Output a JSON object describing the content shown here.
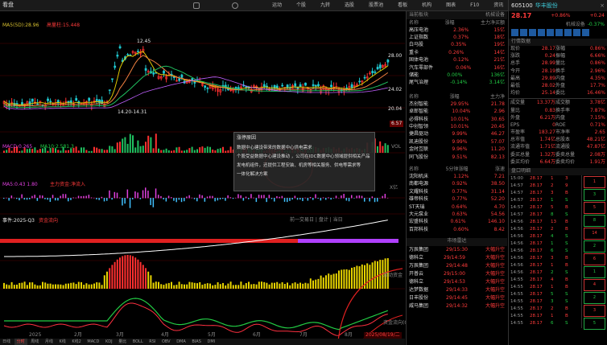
{
  "toolbar": {
    "app_name": "看盘",
    "icons": [
      "refresh-icon",
      "settings-icon",
      "lock-icon",
      "close-icon"
    ],
    "items": [
      "运动",
      "个股",
      "九转",
      "选股",
      "股票池",
      "看板",
      "机构",
      "图表",
      "F10",
      "资讯"
    ],
    "window_buttons": [
      "min",
      "max",
      "close"
    ]
  },
  "chart": {
    "ma_label": "MA5(5D):28.96",
    "highlight_label": "高量柱:15.448",
    "price_high": "12.45",
    "price_labels": [
      "28.00",
      "24.02",
      "20.04",
      "16.06",
      "15.00",
      "12.00"
    ],
    "price_low": "14.20-14.31",
    "mid_label": "14.20-14.31",
    "vol_label": "VOL",
    "vol_value": "6.57",
    "vol_unit": "万手",
    "macd_label": "MACD:0.265",
    "macd_line2": "MA10:2.581.3",
    "ind3_label": "MA5:0.43 1.80",
    "ind3_line2": "主力资金:净流入",
    "ind3_right": "X亿",
    "cyber_label": "事件:2025-Q3",
    "cyber_sub": "资金流向",
    "cyber_right": "前一交易日 | 盘计 | 当日",
    "bottom_label": "资金流向(Q)",
    "bottom_right_label": "流动资金",
    "x_labels": [
      "2025",
      "2月",
      "3月",
      "4月",
      "5月",
      "6月",
      "7月",
      "8月"
    ],
    "date_badge": "2025/08/19/二",
    "y_right": [
      "X亿",
      "X亿",
      "X亿",
      "X亿"
    ]
  },
  "tooltip": {
    "title": "涨停原因",
    "lines": [
      "数据中心建设带来的数据中心供电需求",
      "个股受益数据中心建设推动 ，公司在IDC数据中心领域提供相关产品",
      "发电机组件，还提供工程安装、机房等相关服务、供电等需求等",
      "一体化解决方案"
    ]
  },
  "bottom_tabs": [
    "日线",
    "分时",
    "周线",
    "月线",
    "K线",
    "K线2",
    "MACD",
    "KDJ",
    "量比",
    "BOLL",
    "RSI",
    "OBV",
    "DMA",
    "BIAS",
    "DMI",
    "VR",
    "CCI",
    "WR",
    "SAR",
    "PSY"
  ],
  "bottom_tab_active": 1,
  "sector_panel": {
    "title": "当前板块",
    "title2": "机械设备",
    "col_headers": [
      "名称",
      "涨幅",
      "主力净买额"
    ],
    "rows": [
      {
        "name": "高压电池",
        "pct": "2.36%",
        "amt": "15亿",
        "color": "red"
      },
      {
        "name": "上证指数",
        "pct": "0.37%",
        "amt": "18亿",
        "color": "red"
      },
      {
        "name": "白马股",
        "pct": "0.35%",
        "amt": "19亿",
        "color": "red"
      },
      {
        "name": "重卡",
        "pct": "0.26%",
        "amt": "14亿",
        "color": "red"
      },
      {
        "name": "固体电池",
        "pct": "0.12%",
        "amt": "21亿",
        "color": "red"
      },
      {
        "name": "汽车零部件",
        "pct": "0.06%",
        "amt": "16亿",
        "color": "red"
      },
      {
        "name": "储能",
        "pct": "0.00%",
        "amt": "136亿",
        "color": "grn"
      },
      {
        "name": "尾气治理",
        "pct": "-0.14%",
        "amt": "3.14亿",
        "color": "grn"
      }
    ],
    "section2_headers": [
      "名称",
      "涨幅",
      "主力净"
    ],
    "rows2": [
      {
        "name": "杰创智能",
        "pct": "29.95%",
        "amt": "21.78",
        "color": "red"
      },
      {
        "name": "卓郎智能",
        "pct": "10.04%",
        "amt": "2.96",
        "color": "red"
      },
      {
        "name": "必得科技",
        "pct": "10.01%",
        "amt": "30.65",
        "color": "red"
      },
      {
        "name": "中创智领",
        "pct": "10.01%",
        "amt": "20.45",
        "color": "red"
      },
      {
        "name": "捷昌驱动",
        "pct": "9.99%",
        "amt": "46.27",
        "color": "red"
      },
      {
        "name": "凯迪股份",
        "pct": "9.99%",
        "amt": "57.07",
        "color": "red"
      },
      {
        "name": "金时互联",
        "pct": "9.96%",
        "amt": "11.20",
        "color": "red"
      },
      {
        "name": "同飞股份",
        "pct": "9.51%",
        "amt": "82.13",
        "color": "red"
      }
    ],
    "section3_headers": [
      "名称",
      "5分钟涨幅",
      "涨速"
    ],
    "rows3": [
      {
        "name": "沈阳机床",
        "pct": "1.12%",
        "amt": "7.21",
        "color": "red"
      },
      {
        "name": "南都电源",
        "pct": "0.92%",
        "amt": "38.50",
        "color": "red"
      },
      {
        "name": "文耀科技",
        "pct": "0.77%",
        "amt": "31.14",
        "color": "red"
      },
      {
        "name": "雄帝科技",
        "pct": "0.77%",
        "amt": "52.20",
        "color": "red"
      },
      {
        "name": "ST天瑞",
        "pct": "0.64%",
        "amt": "4.70",
        "color": "red"
      },
      {
        "name": "大元泵业",
        "pct": "0.63%",
        "amt": "54.56",
        "color": "red"
      },
      {
        "name": "宏盛科技",
        "pct": "0.61%",
        "amt": "146.10",
        "color": "red"
      },
      {
        "name": "百邦科技",
        "pct": "0.60%",
        "amt": "8.42",
        "color": "red"
      }
    ],
    "alerts_title": "市场雷达",
    "alerts": [
      {
        "name": "万辰集团",
        "time": "29/15:30",
        "type": "大幅升空"
      },
      {
        "name": "德科立",
        "time": "29/14:59",
        "type": "大幅升空"
      },
      {
        "name": "万辰集团",
        "time": "29/14:48",
        "type": "大幅升空"
      },
      {
        "name": "开普云",
        "time": "29/15:00",
        "type": "大幅升空"
      },
      {
        "name": "德科立",
        "time": "29/14:53",
        "type": "大幅升空"
      },
      {
        "name": "达梦数据",
        "time": "29/14:33",
        "type": "大幅升空"
      },
      {
        "name": "日丰股份",
        "time": "29/14:45",
        "type": "大幅升空"
      },
      {
        "name": "威马集团",
        "time": "29/14:32",
        "type": "大幅升空"
      }
    ]
  },
  "quote_panel": {
    "code": "605100",
    "name": "华丰股份",
    "price": "28.17",
    "change": "+0.86%",
    "change_amt": "+0.24",
    "tag": "机械设备",
    "tag_pct": "-0.37%",
    "section_title": "行情数据",
    "fields": [
      [
        "现价",
        "28.17",
        "涨幅",
        "0.86%"
      ],
      [
        "涨跌",
        "0.24",
        "振幅",
        "6.66%"
      ],
      [
        "总手",
        "28.99",
        "量比",
        "0.86%"
      ],
      [
        "今开",
        "28.19",
        "换手",
        "2.96%"
      ],
      [
        "最高",
        "29.89",
        "内盘",
        "4.35%"
      ],
      [
        "最低",
        "28.02",
        "外盘",
        "17.7%"
      ],
      [
        "均价",
        "25.14",
        "委比",
        "16.46%"
      ]
    ],
    "fields2": [
      [
        "成交量",
        "13.37万",
        "成交额",
        "3.78亿"
      ],
      [
        "量比",
        "0.83",
        "换手率",
        "7.87%"
      ],
      [
        "外盘",
        "6.21万",
        "内盘",
        "7.15%"
      ],
      [
        "EPS",
        "0",
        "ROE",
        "0.71%"
      ],
      [
        "市盈率",
        "183.27",
        "市净率",
        "2.65"
      ],
      [
        "总市值",
        "1.74亿",
        "总股本",
        "48.21亿"
      ],
      [
        "流通市值",
        "1.71亿",
        "流通股",
        "47.87亿"
      ],
      [
        "委买总量",
        "1.32万",
        "委卖总量",
        "2.08万"
      ],
      [
        "委买均价",
        "6.64万",
        "委卖均价",
        "1.91万"
      ]
    ],
    "depth_title": "盘口明细",
    "bids": [
      [
        "15:00",
        "28.17",
        "1",
        "3"
      ],
      [
        "14:57",
        "28.17",
        "2",
        "9"
      ],
      [
        "14:57",
        "28.17",
        "3",
        "B"
      ],
      [
        "14:57",
        "28.17",
        "1",
        "S"
      ],
      [
        "14:57",
        "28.17",
        "5",
        "B"
      ],
      [
        "14:57",
        "28.17",
        "8",
        "S"
      ],
      [
        "14:56",
        "28.17",
        "13",
        "B"
      ],
      [
        "14:56",
        "28.17",
        "2",
        "B"
      ],
      [
        "14:56",
        "28.17",
        "4",
        "S"
      ],
      [
        "14:56",
        "28.17",
        "1",
        "S"
      ],
      [
        "14:56",
        "28.17",
        "6",
        "S"
      ],
      [
        "14:56",
        "28.17",
        "3",
        "B"
      ],
      [
        "14:56",
        "28.17",
        "1",
        "B"
      ],
      [
        "14:56",
        "28.17",
        "2",
        "S"
      ],
      [
        "14:55",
        "28.17",
        "4",
        "B"
      ],
      [
        "14:55",
        "28.17",
        "1",
        "B"
      ],
      [
        "14:55",
        "28.17",
        "5",
        "S"
      ],
      [
        "14:55",
        "28.17",
        "3",
        "S"
      ],
      [
        "14:55",
        "28.17",
        "2",
        "B"
      ],
      [
        "14:55",
        "28.17",
        "1",
        "B"
      ],
      [
        "14:55",
        "28.17",
        "6",
        "S"
      ]
    ],
    "side_values": [
      "1",
      "3",
      "5",
      "8",
      "14",
      "2",
      "6",
      "1",
      "4",
      "2",
      "3",
      "5"
    ]
  }
}
